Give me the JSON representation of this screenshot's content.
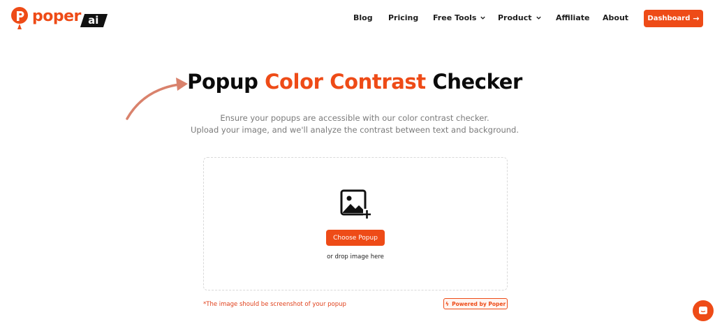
{
  "brand": {
    "name": "poper",
    "suffix": "ai",
    "color": "#ee4b17"
  },
  "nav": {
    "items": [
      {
        "label": "Blog",
        "has_dropdown": false
      },
      {
        "label": "Pricing",
        "has_dropdown": false
      },
      {
        "label": "Free Tools",
        "has_dropdown": true
      },
      {
        "label": "Product",
        "has_dropdown": true
      },
      {
        "label": "Affiliate",
        "has_dropdown": false
      },
      {
        "label": "About",
        "has_dropdown": false
      }
    ],
    "cta_label": "Dashboard",
    "cta_icon": "arrow-right-icon"
  },
  "hero": {
    "title_part1": "Popup ",
    "title_accent": "Color Contrast",
    "title_part2": " Checker",
    "subtitle_line1": "Ensure your popups are accessible with our color contrast checker.",
    "subtitle_line2": "Upload your image, and we'll analyze the contrast between text and background."
  },
  "upload": {
    "icon": "image-add-icon",
    "button_label": "Choose Popup",
    "drop_text": "or drop image here",
    "note": "*The image should be screenshot of your popup",
    "powered_label": "Powered by Poper"
  },
  "chat": {
    "icon": "chat-icon"
  },
  "colors": {
    "accent": "#ee4b17",
    "note_red": "#e0401b",
    "text_muted": "#7a7a7a"
  }
}
